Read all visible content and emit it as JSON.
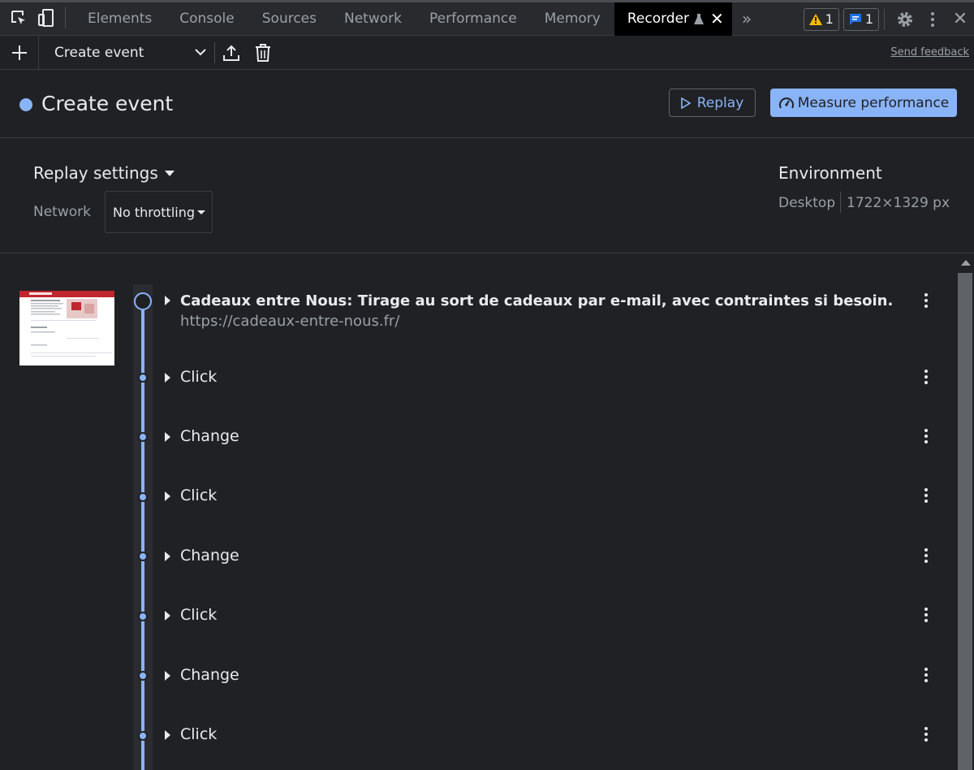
{
  "tabs": [
    {
      "label": "Elements"
    },
    {
      "label": "Console"
    },
    {
      "label": "Sources"
    },
    {
      "label": "Network"
    },
    {
      "label": "Performance"
    },
    {
      "label": "Memory"
    },
    {
      "label": "Recorder"
    }
  ],
  "badges": {
    "warnings": "1",
    "messages": "1"
  },
  "toolbar": {
    "recording_name": "Create event",
    "send_feedback": "Send feedback"
  },
  "header": {
    "title": "Create event",
    "replay_label": "Replay",
    "measure_label": "Measure performance"
  },
  "settings": {
    "title": "Replay settings",
    "network_label": "Network",
    "network_value": "No throttling",
    "environment_title": "Environment",
    "environment_device": "Desktop",
    "environment_size": "1722×1329 px"
  },
  "steps": [
    {
      "title": "Cadeaux entre Nous: Tirage au sort de cadeaux par e-mail, avec contraintes si besoin.",
      "url": "https://cadeaux-entre-nous.fr/"
    },
    {
      "title": "Click"
    },
    {
      "title": "Change"
    },
    {
      "title": "Click"
    },
    {
      "title": "Change"
    },
    {
      "title": "Click"
    },
    {
      "title": "Change"
    },
    {
      "title": "Click"
    }
  ],
  "colors": {
    "accent": "#8ab4f8",
    "background": "#202124",
    "warning": "#fbbc04"
  }
}
